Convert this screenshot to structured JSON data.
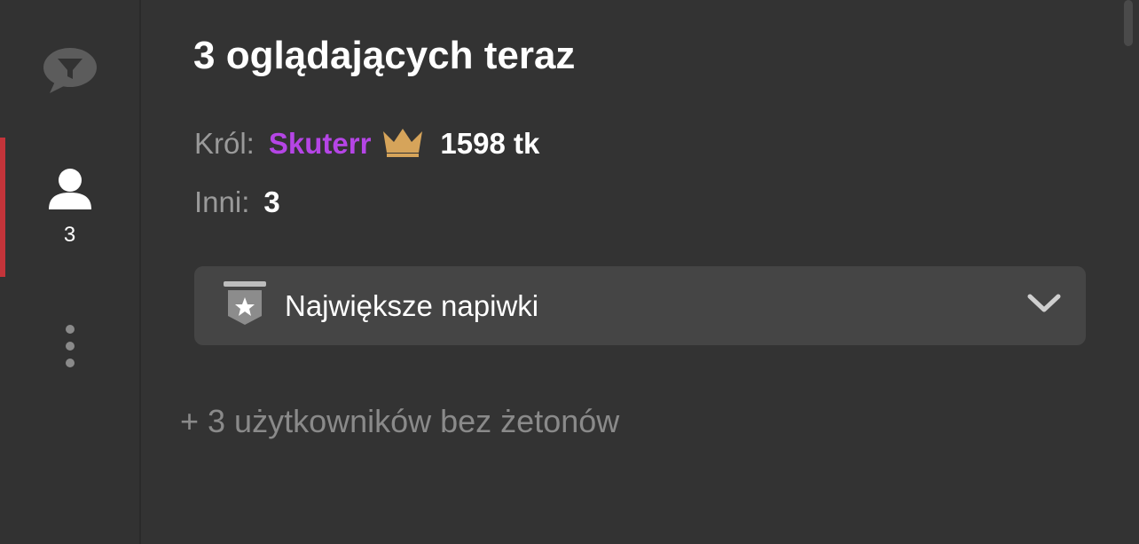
{
  "sidebar": {
    "chat_icon": "speech-bubble-filter-icon",
    "users_icon": "user-icon",
    "users_count": "3",
    "more_icon": "vertical-ellipsis-icon",
    "active_color": "#c4343a"
  },
  "main": {
    "title": "3 oglądających teraz",
    "king": {
      "label": "Król:",
      "name": "Skuterr",
      "name_color": "#b545e6",
      "icon": "crown-icon",
      "icon_color": "#d6a45a",
      "tokens": "1598 tk"
    },
    "others": {
      "label": "Inni:",
      "value": "3"
    },
    "dropdown": {
      "icon": "star-shield-icon",
      "label": "Największe napiwki",
      "chevron": "chevron-down-icon"
    },
    "extra_users": "+ 3 użytkowników bez żetonów"
  }
}
